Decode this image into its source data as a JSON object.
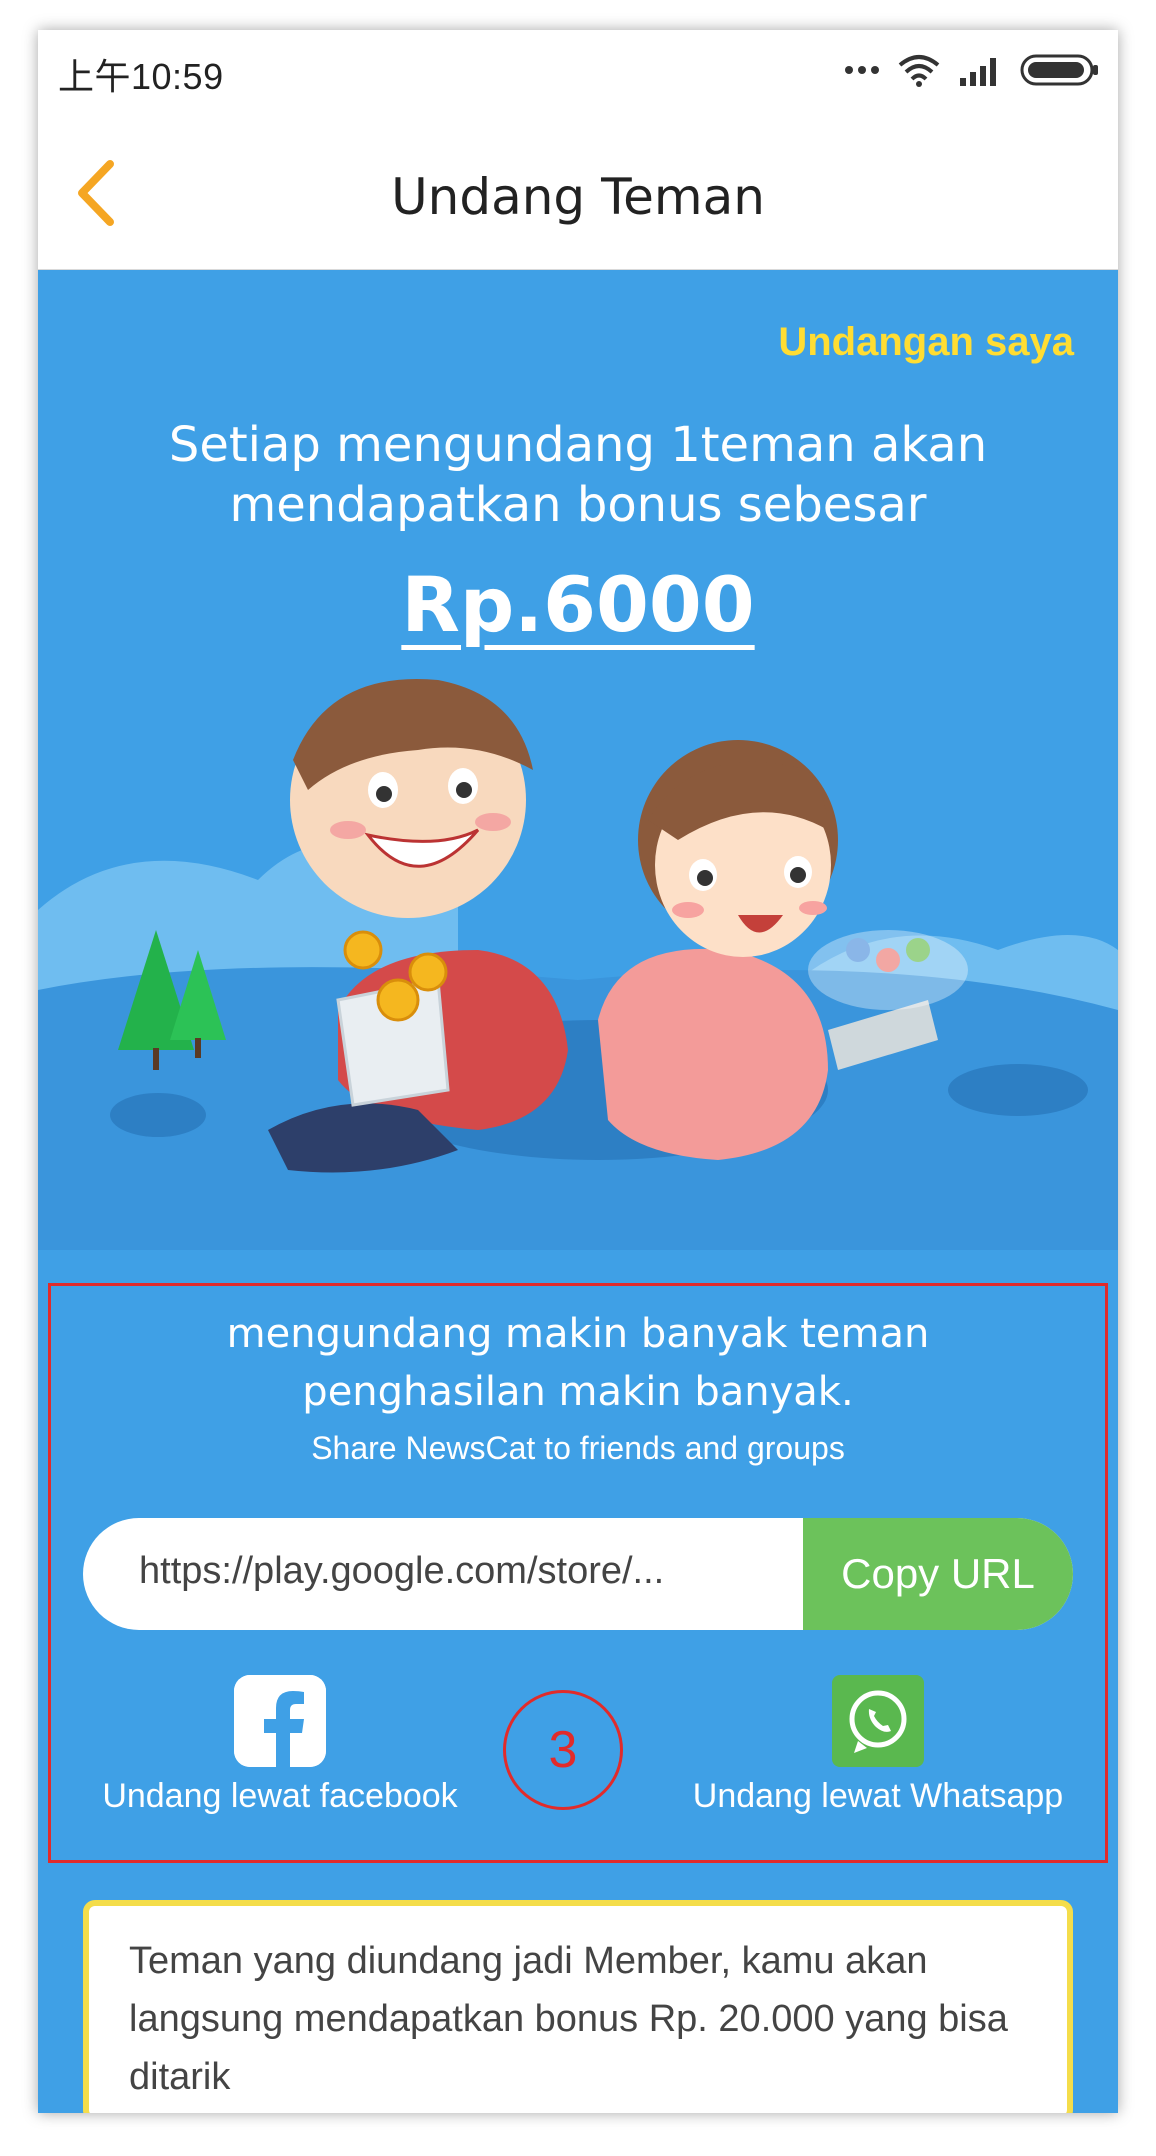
{
  "status_bar": {
    "time": "上午10:59",
    "icons": [
      "more-dots-icon",
      "wifi-icon",
      "signal-icon",
      "battery-icon"
    ]
  },
  "header": {
    "back_icon": "chevron-left-icon",
    "title": "Undang Teman"
  },
  "main": {
    "my_invites_link": "Undangan saya",
    "headline_line1": "Setiap mengundang 1teman akan",
    "headline_line2": "mendapatkan bonus sebesar",
    "bonus_amount": "Rp.6000",
    "promo_line1": "mengundang makin banyak teman",
    "promo_line2": "penghasilan makin banyak.",
    "share_subtitle": "Share NewsCat to friends and groups",
    "share_url": "https://play.google.com/store/...",
    "copy_button": "Copy URL",
    "share_facebook_label": "Undang lewat facebook",
    "share_whatsapp_label": "Undang lewat Whatsapp",
    "step_marker": "3",
    "info_text": "Teman yang diundang jadi Member, kamu akan langsung mendapatkan bonus Rp. 20.000 yang bisa ditarik"
  },
  "colors": {
    "background_blue": "#3fa0e6",
    "accent_yellow": "#ffdd33",
    "back_orange": "#f5a623",
    "copy_green": "#6cc25b",
    "annotation_red": "#e12b2b",
    "info_border": "#f4dd4b"
  }
}
